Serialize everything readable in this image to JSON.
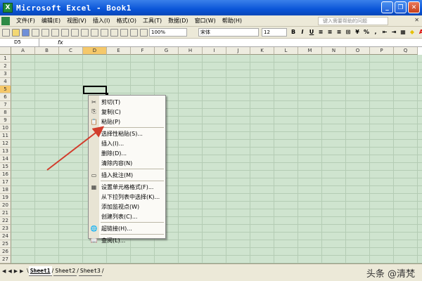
{
  "window": {
    "title": "Microsoft Excel - Book1",
    "app_icon": "X"
  },
  "menubar": {
    "items": [
      "文件(F)",
      "编辑(E)",
      "视图(V)",
      "插入(I)",
      "格式(O)",
      "工具(T)",
      "数据(D)",
      "窗口(W)",
      "帮助(H)"
    ],
    "help_placeholder": "键入需要帮助的问题"
  },
  "toolbar": {
    "zoom": "100%",
    "font_name": "宋体",
    "font_size": "12"
  },
  "formula_bar": {
    "name_box": "D5",
    "fx": "fx"
  },
  "columns": [
    "A",
    "B",
    "C",
    "D",
    "E",
    "F",
    "G",
    "H",
    "I",
    "J",
    "K",
    "L",
    "M",
    "N",
    "O",
    "P",
    "Q"
  ],
  "rows": [
    "1",
    "2",
    "3",
    "4",
    "5",
    "6",
    "7",
    "8",
    "9",
    "10",
    "11",
    "12",
    "13",
    "14",
    "15",
    "16",
    "17",
    "18",
    "19",
    "20",
    "21",
    "22",
    "23",
    "24",
    "25",
    "26",
    "27"
  ],
  "active_cell": "D5",
  "context_menu": {
    "items": [
      {
        "label": "剪切(T)",
        "icon": "scissors-icon",
        "glyph": "✂"
      },
      {
        "label": "复制(C)",
        "icon": "copy-icon",
        "glyph": "⎘"
      },
      {
        "label": "粘贴(P)",
        "icon": "paste-icon",
        "glyph": "📋"
      },
      {
        "label": "选择性粘贴(S)...",
        "icon": "",
        "glyph": ""
      },
      {
        "label": "插入(I)...",
        "icon": "",
        "glyph": ""
      },
      {
        "label": "删除(D)...",
        "icon": "",
        "glyph": ""
      },
      {
        "label": "清除内容(N)",
        "icon": "",
        "glyph": ""
      },
      {
        "label": "插入批注(M)",
        "icon": "comment-icon",
        "glyph": "▭"
      },
      {
        "label": "设置单元格格式(F)...",
        "icon": "format-cells-icon",
        "glyph": "▦"
      },
      {
        "label": "从下拉列表中选择(K)...",
        "icon": "",
        "glyph": ""
      },
      {
        "label": "添加监视点(W)",
        "icon": "",
        "glyph": ""
      },
      {
        "label": "创建列表(C)...",
        "icon": "",
        "glyph": ""
      },
      {
        "label": "超链接(H)...",
        "icon": "hyperlink-icon",
        "glyph": "🌐"
      },
      {
        "label": "查阅(L)...",
        "icon": "research-icon",
        "glyph": "📖"
      }
    ]
  },
  "sheets": {
    "tabs": [
      "Sheet1",
      "Sheet2",
      "Sheet3"
    ],
    "active": "Sheet1"
  },
  "watermark": "头条 @清梵",
  "colors": {
    "grid_bg": "#cfe4cf",
    "arrow": "#d23c2c",
    "title_bar": "#0a55d8"
  }
}
